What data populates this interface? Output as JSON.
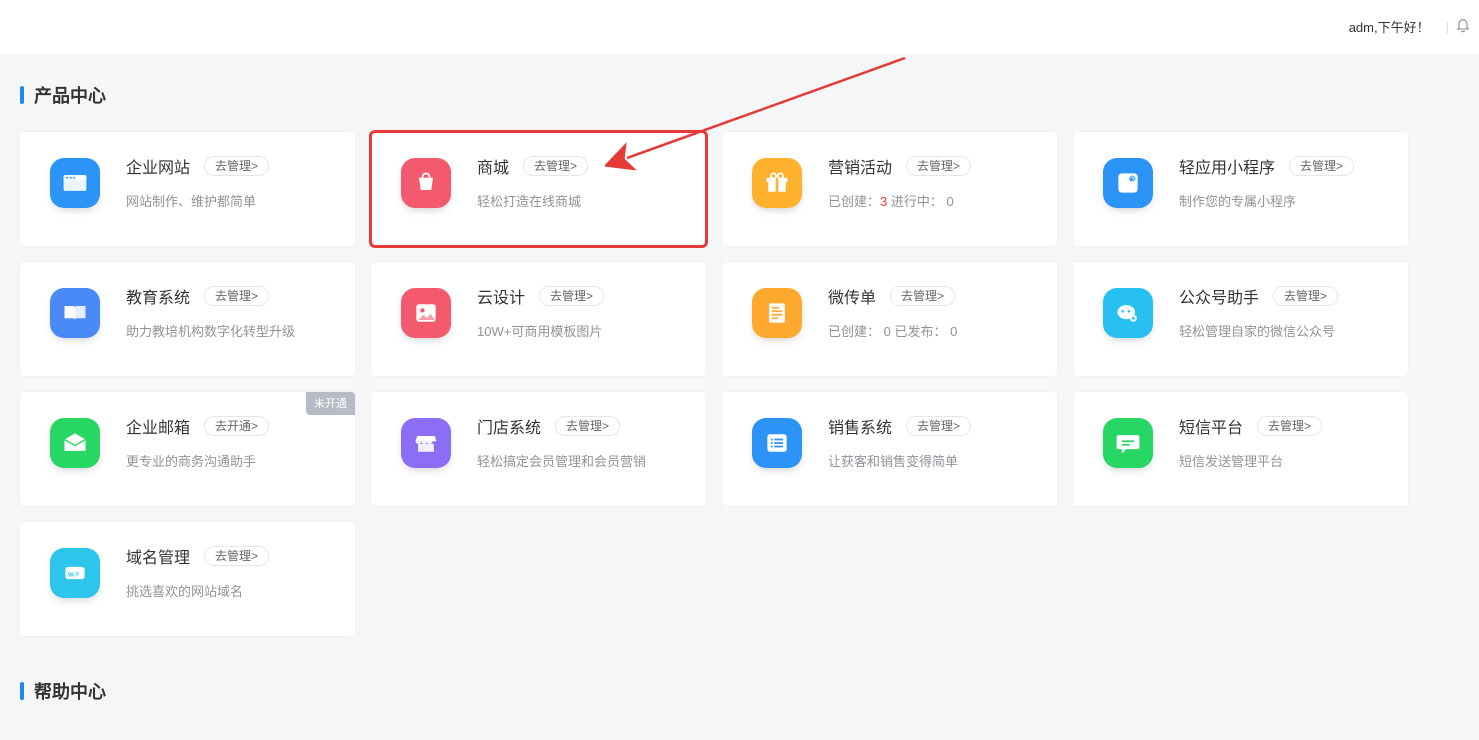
{
  "header": {
    "greeting": "adm,下午好！",
    "divider": "|"
  },
  "sections": {
    "products": "产品中心",
    "help": "帮助中心"
  },
  "common": {
    "manage": "去管理>",
    "open": "去开通>"
  },
  "badges": {
    "unopened": "未开通"
  },
  "cards": [
    {
      "title": "企业网站",
      "sub": "网站制作、维护都简单",
      "btnKey": "common.manage",
      "iconBg": "#2b94f6",
      "icon": "website-icon"
    },
    {
      "title": "商城",
      "sub": "轻松打造在线商城",
      "btnKey": "common.manage",
      "iconBg": "#f45a6e",
      "icon": "shop-icon",
      "highlight": true
    },
    {
      "title": "营销活动",
      "subPrefix": "已创建：",
      "subCount": "3",
      "subSuffix": "   进行中： 0",
      "btnKey": "common.manage",
      "iconBg": "#ffb22e",
      "icon": "gift-icon"
    },
    {
      "title": "轻应用小程序",
      "sub": "制作您的专属小程序",
      "btnKey": "common.manage",
      "iconBg": "#2b94f6",
      "icon": "miniapp-icon"
    },
    {
      "title": "教育系统",
      "sub": "助力教培机构数字化转型升级",
      "btnKey": "common.manage",
      "iconBg": "#4a8af7",
      "icon": "edu-icon"
    },
    {
      "title": "云设计",
      "sub": "10W+可商用模板图片",
      "btnKey": "common.manage",
      "iconBg": "#f45a6e",
      "icon": "image-icon"
    },
    {
      "title": "微传单",
      "sub": "已创建： 0   已发布： 0",
      "btnKey": "common.manage",
      "iconBg": "#ffa92e",
      "icon": "flyer-icon"
    },
    {
      "title": "公众号助手",
      "sub": "轻松管理自家的微信公众号",
      "btnKey": "common.manage",
      "iconBg": "#28c0f0",
      "icon": "wechat-icon"
    },
    {
      "title": "企业邮箱",
      "sub": "更专业的商务沟通助手",
      "btnKey": "common.open",
      "iconBg": "#28d663",
      "icon": "mail-icon",
      "badge": "badges.unopened"
    },
    {
      "title": "门店系统",
      "sub": "轻松搞定会员管理和会员营销",
      "btnKey": "common.manage",
      "iconBg": "#8b6df6",
      "icon": "store-icon"
    },
    {
      "title": "销售系统",
      "sub": "让获客和销售变得简单",
      "btnKey": "common.manage",
      "iconBg": "#2b94f6",
      "icon": "list-icon"
    },
    {
      "title": "短信平台",
      "sub": "短信发送管理平台",
      "btnKey": "common.manage",
      "iconBg": "#28d663",
      "icon": "sms-icon"
    },
    {
      "title": "域名管理",
      "sub": "挑选喜欢的网站域名",
      "btnKey": "common.manage",
      "iconBg": "#2bc6e9",
      "icon": "domain-icon"
    }
  ]
}
